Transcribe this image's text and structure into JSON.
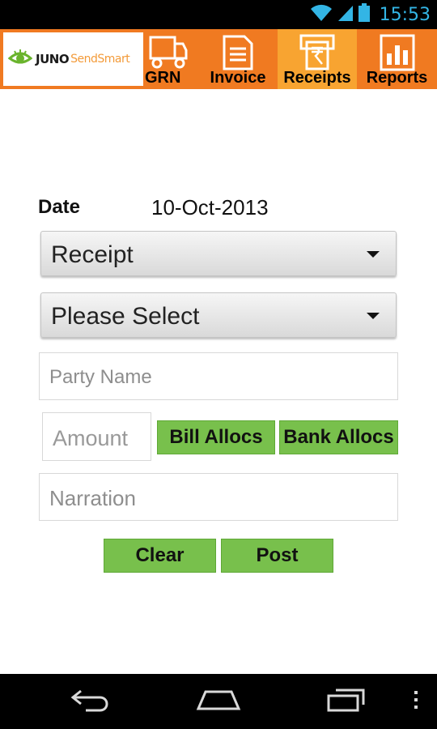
{
  "status_bar": {
    "time": "15:53"
  },
  "app": {
    "logo_brand": "JUNO",
    "logo_tagline": "SendSmart"
  },
  "tabs": [
    {
      "label": "GRN",
      "icon": "truck-icon"
    },
    {
      "label": "Invoice",
      "icon": "document-icon"
    },
    {
      "label": "Receipts",
      "icon": "rupee-receipt-icon",
      "selected": true
    },
    {
      "label": "Reports",
      "icon": "bar-chart-icon"
    }
  ],
  "form": {
    "date_label": "Date",
    "date_value": "10-Oct-2013",
    "voucher_type": "Receipt",
    "account_select": "Please Select",
    "party_name_placeholder": "Party Name",
    "amount_placeholder": "Amount",
    "narration_placeholder": "Narration",
    "bill_allocs_label": "Bill Allocs",
    "bank_allocs_label": "Bank Allocs",
    "clear_label": "Clear",
    "post_label": "Post"
  },
  "colors": {
    "header_orange": "#f07a21",
    "selected_tab": "#f8a431",
    "button_green": "#78c04c",
    "clock_blue": "#33b5e5"
  }
}
